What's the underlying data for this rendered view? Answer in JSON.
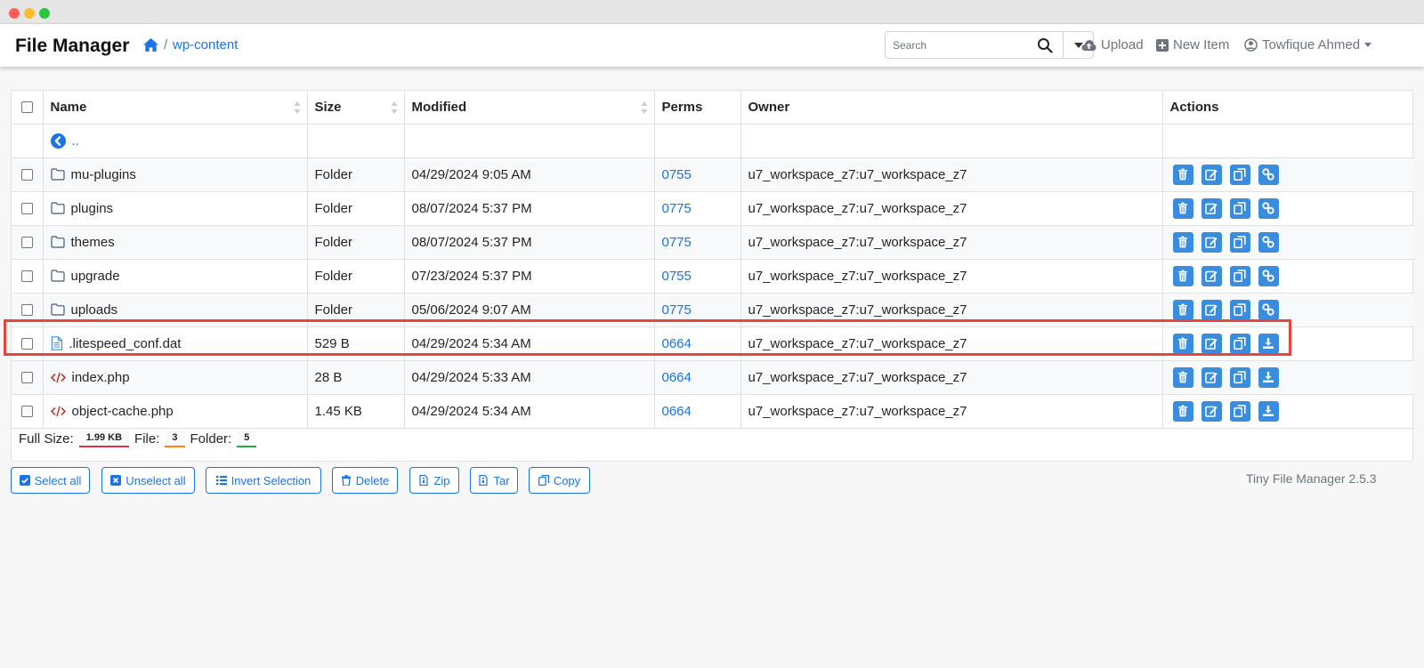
{
  "app": {
    "title": "File Manager",
    "breadcrumb": {
      "separator": "/",
      "current": "wp-content"
    },
    "version": "Tiny File Manager 2.5.3"
  },
  "search": {
    "placeholder": "Search",
    "value": ""
  },
  "nav": {
    "upload": "Upload",
    "new_item": "New Item",
    "user": "Towfique Ahmed"
  },
  "table": {
    "headers": {
      "name": "Name",
      "size": "Size",
      "modified": "Modified",
      "perms": "Perms",
      "owner": "Owner",
      "actions": "Actions"
    },
    "parent_label": "..",
    "rows": [
      {
        "name": "mu-plugins",
        "type": "folder",
        "size": "Folder",
        "modified": "04/29/2024 9:05 AM",
        "perms": "0755",
        "owner": "u7_workspace_z7:u7_workspace_z7"
      },
      {
        "name": "plugins",
        "type": "folder",
        "size": "Folder",
        "modified": "08/07/2024 5:37 PM",
        "perms": "0775",
        "owner": "u7_workspace_z7:u7_workspace_z7"
      },
      {
        "name": "themes",
        "type": "folder",
        "size": "Folder",
        "modified": "08/07/2024 5:37 PM",
        "perms": "0775",
        "owner": "u7_workspace_z7:u7_workspace_z7"
      },
      {
        "name": "upgrade",
        "type": "folder",
        "size": "Folder",
        "modified": "07/23/2024 5:37 PM",
        "perms": "0755",
        "owner": "u7_workspace_z7:u7_workspace_z7"
      },
      {
        "name": "uploads",
        "type": "folder",
        "size": "Folder",
        "modified": "05/06/2024 9:07 AM",
        "perms": "0775",
        "owner": "u7_workspace_z7:u7_workspace_z7"
      },
      {
        "name": ".litespeed_conf.dat",
        "type": "file",
        "size": "529 B",
        "modified": "04/29/2024 5:34 AM",
        "perms": "0664",
        "owner": "u7_workspace_z7:u7_workspace_z7"
      },
      {
        "name": "index.php",
        "type": "code",
        "size": "28 B",
        "modified": "04/29/2024 5:33 AM",
        "perms": "0664",
        "owner": "u7_workspace_z7:u7_workspace_z7"
      },
      {
        "name": "object-cache.php",
        "type": "code",
        "size": "1.45 KB",
        "modified": "04/29/2024 5:34 AM",
        "perms": "0664",
        "owner": "u7_workspace_z7:u7_workspace_z7"
      }
    ]
  },
  "summary": {
    "full_size_label": "Full Size:",
    "full_size": "1.99 KB",
    "file_label": "File:",
    "file_count": "3",
    "folder_label": "Folder:",
    "folder_count": "5"
  },
  "buttons": {
    "select_all": "Select all",
    "unselect_all": "Unselect all",
    "invert_selection": "Invert Selection",
    "delete": "Delete",
    "zip": "Zip",
    "tar": "Tar",
    "copy": "Copy"
  },
  "colors": {
    "accent": "#1a73e8",
    "action_button": "#3a8dde",
    "highlight": "#e8453c",
    "code_icon": "#c0392b"
  }
}
